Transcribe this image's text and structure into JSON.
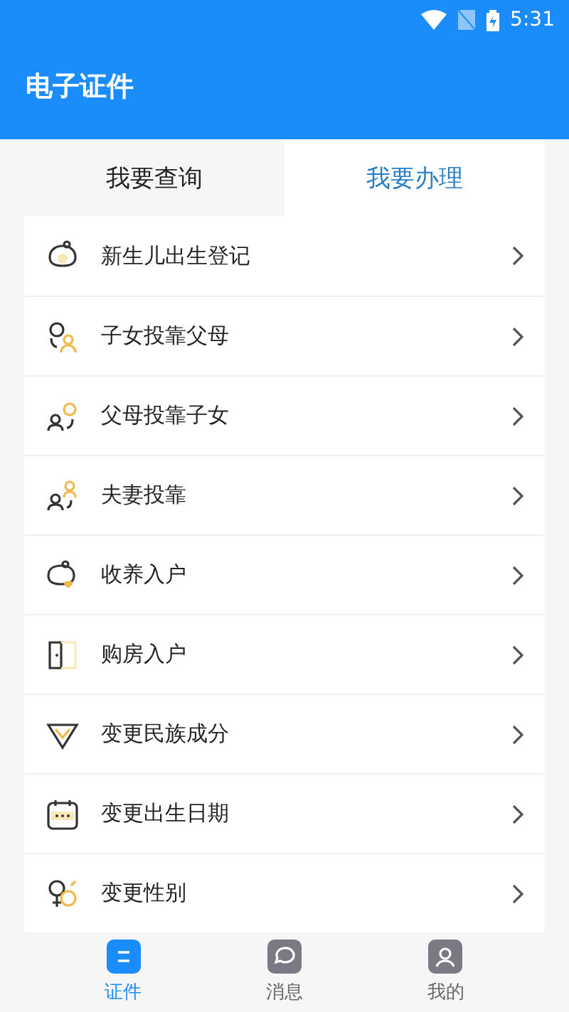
{
  "status_bar": {
    "time": "5:31"
  },
  "app_bar": {
    "title": "电子证件"
  },
  "tabs": [
    {
      "label": "我要查询",
      "selected": false
    },
    {
      "label": "我要办理",
      "selected": true
    }
  ],
  "items": [
    {
      "label": "新生儿出生登记",
      "kind": "baby"
    },
    {
      "label": "子女投靠父母",
      "kind": "child"
    },
    {
      "label": "父母投靠子女",
      "kind": "parent"
    },
    {
      "label": "夫妻投靠",
      "kind": "spouse"
    },
    {
      "label": "收养入户",
      "kind": "adopt"
    },
    {
      "label": "购房入户",
      "kind": "door"
    },
    {
      "label": "变更民族成分",
      "kind": "ethnic"
    },
    {
      "label": "变更出生日期",
      "kind": "calendar"
    },
    {
      "label": "变更性别",
      "kind": "gender"
    }
  ],
  "bottom_nav": [
    {
      "label": "证件",
      "kind": "card",
      "selected": true
    },
    {
      "label": "消息",
      "kind": "message",
      "selected": false
    },
    {
      "label": "我的",
      "kind": "user",
      "selected": false
    }
  ]
}
